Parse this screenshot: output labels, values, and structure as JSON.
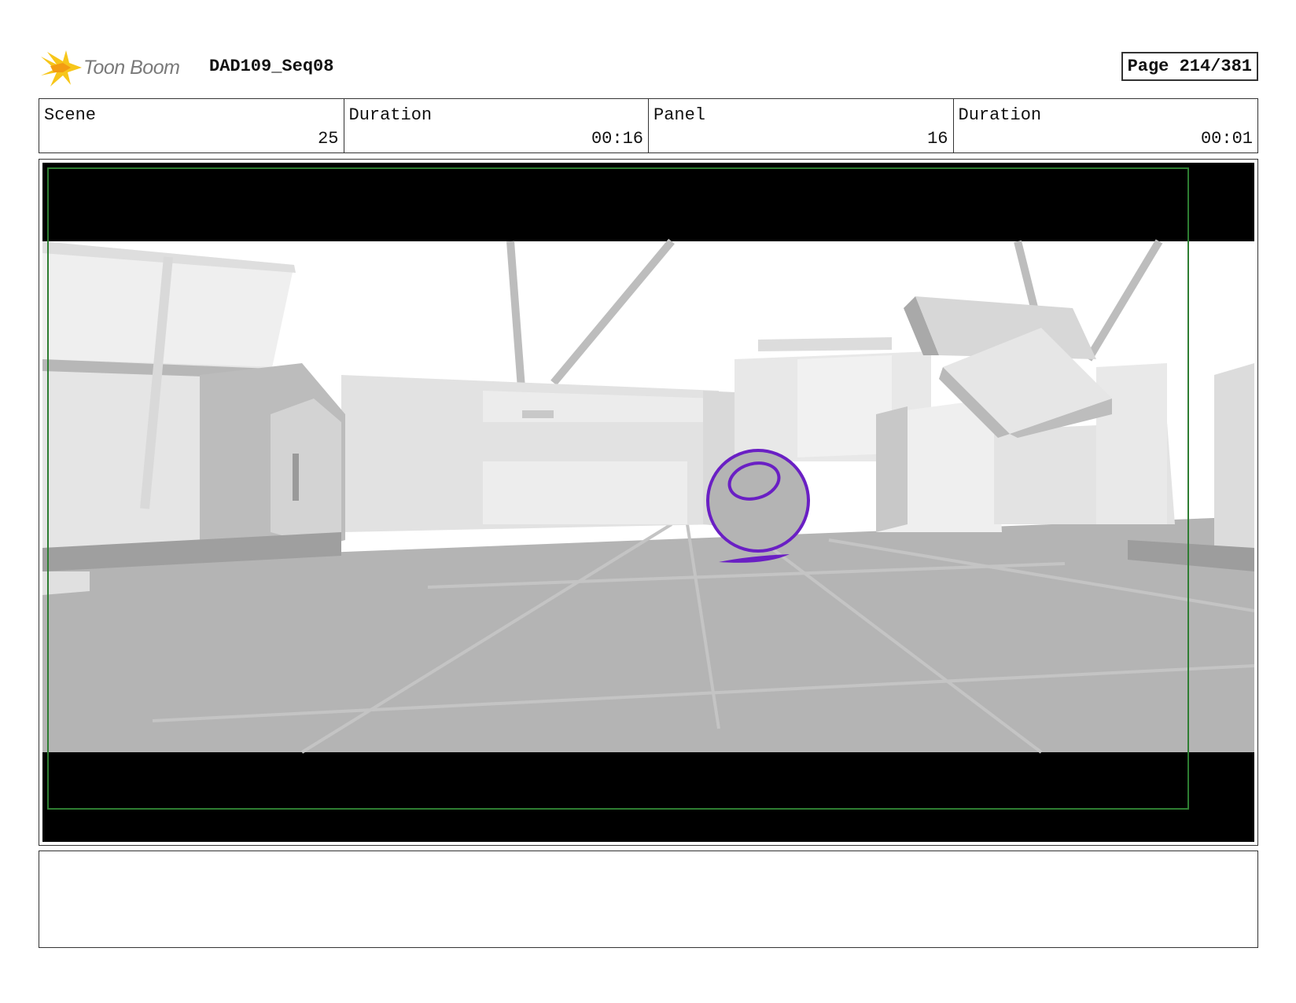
{
  "header": {
    "brand": "Toon Boom",
    "logo_icon": "toon-boom-star-icon",
    "project": "DAD109_Seq08",
    "page": "Page 214/381"
  },
  "info": {
    "scene_label": "Scene",
    "scene_value": "25",
    "scene_duration_label": "Duration",
    "scene_duration_value": "00:16",
    "panel_label": "Panel",
    "panel_value": "16",
    "panel_duration_label": "Duration",
    "panel_duration_value": "00:01"
  },
  "panel": {
    "description": "",
    "colors": {
      "letterbox": "#000000",
      "safe_frame": "#2e7d32",
      "floor": "#b4b4b4",
      "sky": "#ffffff",
      "character_sketch": "#6a1fc4"
    }
  },
  "notes": {
    "text": ""
  }
}
